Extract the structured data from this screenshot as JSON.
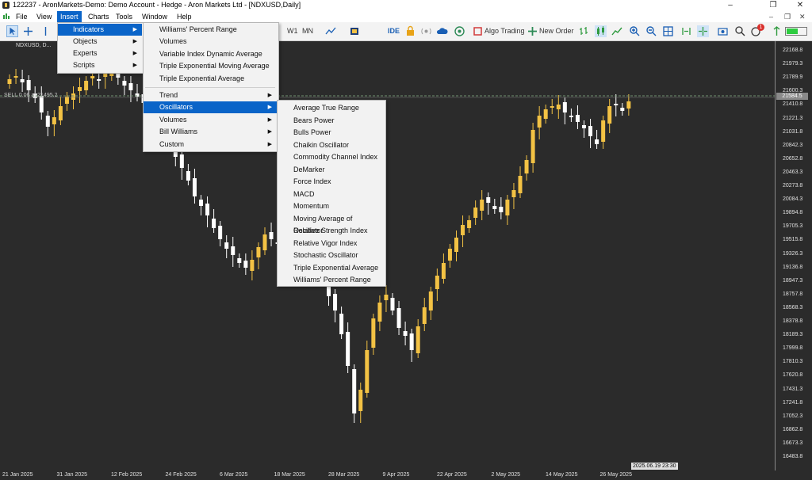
{
  "window": {
    "title": "122237 - AronMarkets-Demo: Demo Account - Hedge - Aron Markets Ltd - [NDXUSD,Daily]",
    "controls": [
      "–",
      "❐",
      "✕"
    ]
  },
  "menubar": {
    "items": [
      "File",
      "View",
      "Insert",
      "Charts",
      "Tools",
      "Window",
      "Help"
    ],
    "active": "Insert",
    "right_controls": [
      "–",
      "❐",
      "✕"
    ]
  },
  "toolbar": {
    "timeframes": [
      "W1",
      "MN"
    ],
    "ide": "IDE",
    "algo_trading": "Algo Trading",
    "new_order": "New Order",
    "notification_count": "1"
  },
  "chart": {
    "symbol_label": "NDXUSD, D...",
    "sell_label": "SELL 0.06 at 21495.2",
    "bg_color": "#2b2b2b",
    "bull_color": "#f3c244",
    "bear_color": "#ffffff",
    "price_box": "21584.5",
    "date_box": "2025.06.19 23:30",
    "y_labels": [
      "22168.8",
      "21979.3",
      "21789.9",
      "21600.3",
      "21410.8",
      "21221.3",
      "21031.8",
      "20842.3",
      "20652.8",
      "20463.3",
      "20273.8",
      "20084.3",
      "19894.8",
      "19705.3",
      "19515.8",
      "19326.3",
      "19136.8",
      "18947.3",
      "18757.8",
      "18568.3",
      "18378.8",
      "18189.3",
      "17999.8",
      "17810.3",
      "17620.8",
      "17431.3",
      "17241.8",
      "17052.3",
      "16862.8",
      "16673.3",
      "16483.8"
    ],
    "x_labels": [
      "21 Jan 2025",
      "31 Jan 2025",
      "12 Feb 2025",
      "24 Feb 2025",
      "6 Mar 2025",
      "18 Mar 2025",
      "28 Mar 2025",
      "9 Apr 2025",
      "22 Apr 2025",
      "2 May 2025",
      "14 May 2025",
      "26 May 2025"
    ]
  },
  "insert_menu": {
    "items": [
      {
        "label": "Indicators",
        "submenu": true
      },
      {
        "label": "Objects",
        "submenu": true
      },
      {
        "label": "Experts",
        "submenu": true
      },
      {
        "label": "Scripts",
        "submenu": true
      }
    ]
  },
  "indicators_menu": {
    "recent": [
      "Williams' Percent Range",
      "Volumes",
      "Variable Index Dynamic Average",
      "Triple Exponential Moving Average",
      "Triple Exponential Average"
    ],
    "categories": [
      {
        "label": "Trend",
        "submenu": true
      },
      {
        "label": "Oscillators",
        "submenu": true
      },
      {
        "label": "Volumes",
        "submenu": true
      },
      {
        "label": "Bill Williams",
        "submenu": true
      },
      {
        "label": "Custom",
        "submenu": true
      }
    ]
  },
  "oscillators_menu": {
    "items": [
      "Average True Range",
      "Bears Power",
      "Bulls Power",
      "Chaikin Oscillator",
      "Commodity Channel Index",
      "DeMarker",
      "Force Index",
      "MACD",
      "Momentum",
      "Moving Average of Oscillator",
      "Relative Strength Index",
      "Relative Vigor Index",
      "Stochastic Oscillator",
      "Triple Exponential Average",
      "Williams' Percent Range"
    ]
  }
}
